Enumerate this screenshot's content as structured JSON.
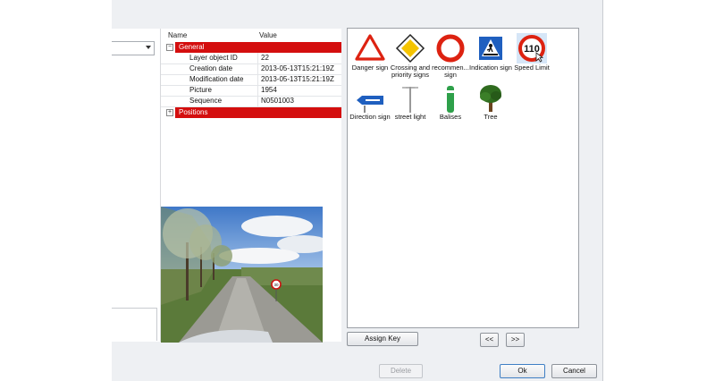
{
  "properties": {
    "header": {
      "name": "Name",
      "value": "Value"
    },
    "general_label": "General",
    "rows": [
      {
        "label": "Layer object ID",
        "value": "22"
      },
      {
        "label": "Creation date",
        "value": "2013-05-13T15:21:19Z"
      },
      {
        "label": "Modification date",
        "value": "2013-05-13T15:21:19Z"
      },
      {
        "label": "Picture",
        "value": "1954"
      },
      {
        "label": "Sequence",
        "value": "N0501003"
      }
    ],
    "positions_label": "Positions",
    "expander_collapse": "−",
    "expander_expand": "+"
  },
  "photo": {
    "sign_number": "30"
  },
  "symbols": [
    {
      "caption": "Danger sign",
      "icon": "danger-sign-icon"
    },
    {
      "caption": "Crossing and priority signs",
      "icon": "priority-road-icon"
    },
    {
      "caption": "recommen... sign",
      "icon": "recommended-sign-icon"
    },
    {
      "caption": "Indication sign",
      "icon": "pedestrian-crossing-icon"
    },
    {
      "caption": "Speed Limit",
      "icon": "speed-limit-icon",
      "number": "110"
    },
    {
      "caption": "Direction sign",
      "icon": "direction-sign-icon"
    },
    {
      "caption": "street light",
      "icon": "street-light-icon"
    },
    {
      "caption": "Balises",
      "icon": "balise-icon"
    },
    {
      "caption": "Tree",
      "icon": "tree-icon"
    }
  ],
  "buttons": {
    "assign_key": "Assign Key",
    "prev": "<<",
    "next": ">>",
    "delete": "Delete",
    "ok": "Ok",
    "cancel": "Cancel"
  },
  "colors": {
    "accent_red": "#d40e0e",
    "selection": "#d6e6f7"
  }
}
